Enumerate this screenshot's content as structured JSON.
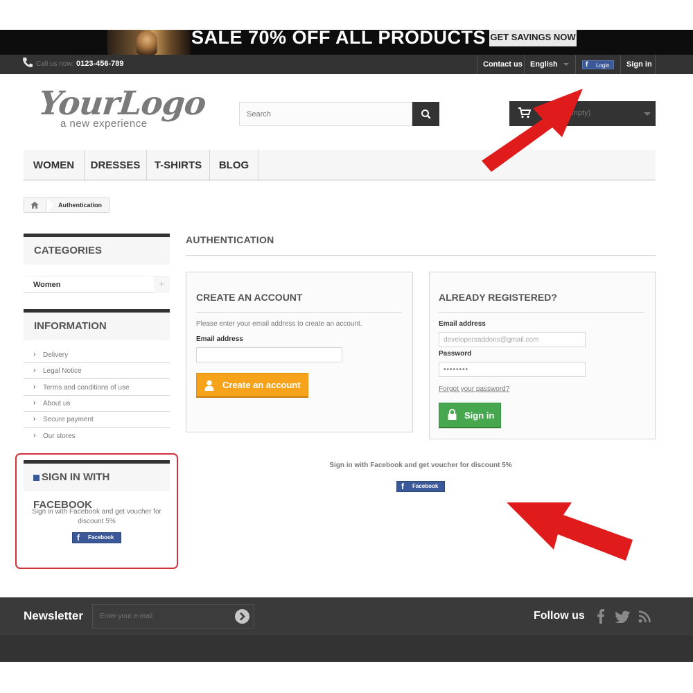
{
  "banner": {
    "title": "SALE 70% OFF ALL PRODUCTS",
    "button": "GET SAVINGS NOW"
  },
  "topnav": {
    "phone_label": "Call us now:",
    "phone_number": "0123-456-789",
    "contact": "Contact us",
    "language": "English",
    "fb_login": "Login",
    "signin": "Sign in"
  },
  "header": {
    "logo_main": "YourLogo",
    "logo_sub": "a new experience",
    "search_placeholder": "Search",
    "cart_status": "(empty)"
  },
  "menu": {
    "items": [
      "Women",
      "Dresses",
      "T-shirts",
      "Blog"
    ]
  },
  "breadcrumb": {
    "current": "Authentication"
  },
  "sidebar": {
    "categories_title": "CATEGORIES",
    "categories": [
      "Women"
    ],
    "information_title": "INFORMATION",
    "information_items": [
      "Delivery",
      "Legal Notice",
      "Terms and conditions of use",
      "About us",
      "Secure payment",
      "Our stores"
    ],
    "facebook_title": "SIGN IN WITH FACEBOOK",
    "facebook_text": "Sign in with Facebook and get voucher for discount 5%",
    "facebook_button": "Facebook"
  },
  "auth": {
    "title": "AUTHENTICATION",
    "create": {
      "title": "CREATE AN ACCOUNT",
      "text": "Please enter your email address to create an account.",
      "email_label": "Email address",
      "email_value": "",
      "button": "Create an account"
    },
    "login": {
      "title": "ALREADY REGISTERED?",
      "email_label": "Email address",
      "email_value": "developersaddons@gmail.com",
      "password_label": "Password",
      "password_value": "••••••••",
      "forgot": "Forgot your password?",
      "button": "Sign in"
    },
    "facebook_text": "Sign in with Facebook and get voucher for discount 5%",
    "facebook_button": "Facebook"
  },
  "footer": {
    "newsletter_label": "Newsletter",
    "newsletter_placeholder": "Enter your e-mail",
    "follow_label": "Follow us"
  },
  "colors": {
    "dark": "#333333",
    "orange": "#f7a21b",
    "green": "#46a74e",
    "facebook": "#3b5998",
    "annotation_red": "#e01b1b"
  }
}
